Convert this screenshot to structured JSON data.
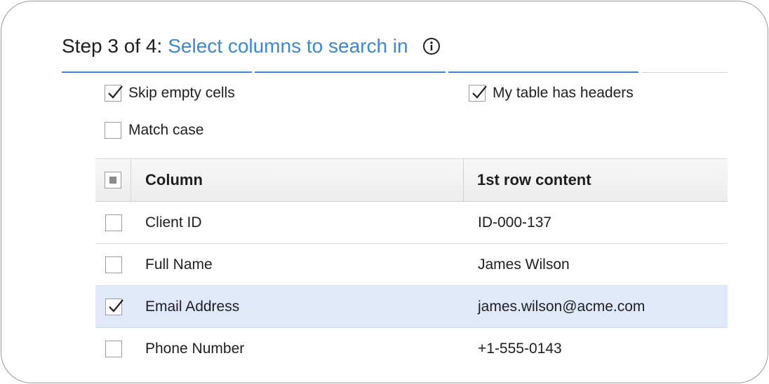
{
  "header": {
    "step_prefix": "Step 3 of 4:",
    "step_title": "Select columns to search in",
    "info_icon": "info-circle-icon"
  },
  "progress": {
    "total_steps": 4,
    "current_step": 3
  },
  "options": {
    "skip_empty": {
      "label": "Skip empty cells",
      "checked": true
    },
    "has_headers": {
      "label": "My table has headers",
      "checked": true
    },
    "match_case": {
      "label": "Match case",
      "checked": false
    }
  },
  "table": {
    "headers": {
      "column": "Column",
      "content": "1st row content"
    },
    "rows": [
      {
        "column": "Client ID",
        "content": "ID-000-137",
        "checked": false
      },
      {
        "column": "Full Name",
        "content": "James Wilson",
        "checked": false
      },
      {
        "column": "Email Address",
        "content": "james.wilson@acme.com",
        "checked": true
      },
      {
        "column": "Phone Number",
        "content": "+1-555-0143",
        "checked": false
      }
    ]
  },
  "colors": {
    "accent": "#3b87dc",
    "selected_row": "#dfe9fa"
  }
}
